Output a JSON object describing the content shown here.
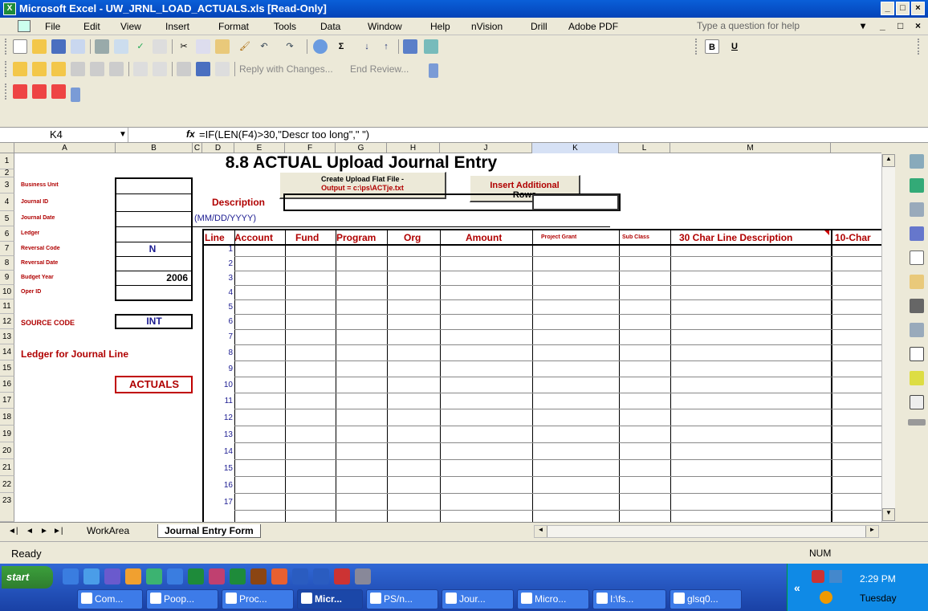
{
  "window": {
    "title": "Microsoft Excel - UW_JRNL_LOAD_ACTUALS.xls [Read-Only]",
    "controls": [
      "_",
      "□",
      "×"
    ]
  },
  "menu": {
    "items": [
      "File",
      "Edit",
      "View",
      "Insert",
      "Format",
      "Tools",
      "Data",
      "Window",
      "Help",
      "nVision",
      "Drill",
      "Adobe PDF"
    ],
    "help_placeholder": "Type a question for help",
    "help_controls": [
      "▾",
      "_",
      "□",
      "×"
    ]
  },
  "toolbar": {
    "reviewing_text": "Reply with Changes...",
    "end_review": "End Review...",
    "font_bold": "B",
    "font_underline": "U"
  },
  "formula_bar": {
    "name_box": "K4",
    "fx": "fx",
    "formula": "=IF(LEN(F4)>30,\"Descr too long\",\" \")"
  },
  "columns": [
    "A",
    "B",
    "C",
    "D",
    "E",
    "F",
    "G",
    "H",
    "J",
    "K",
    "L",
    "M"
  ],
  "rows": [
    "1",
    "2",
    "3",
    "4",
    "5",
    "6",
    "7",
    "8",
    "9",
    "10",
    "11",
    "12",
    "13",
    "14",
    "15",
    "16",
    "17",
    "18",
    "19",
    "20",
    "21",
    "22",
    "23"
  ],
  "sheet": {
    "title": "8.8 ACTUAL Upload Journal Entry",
    "create_button": "Create Upload Flat File - Output = c:\\ps\\ACTje.txt",
    "create_button_line1": "Create Upload Flat File -",
    "create_button_line2": "Output = c:\\ps\\ACTje.txt",
    "insert_button_line1": "Insert Additional",
    "insert_button_line2": "Rows",
    "left_labels": {
      "business_unit": "Business Unit",
      "journal_id": "Journal ID",
      "journal_date": "Journal Date",
      "ledger": "Ledger",
      "reversal_code": "Reversal Code",
      "reversal_date": "Reversal Date",
      "budget_year": "Budget Year",
      "oper_id": "Oper ID",
      "source_code": "SOURCE CODE",
      "ledger_for_line": "Ledger for Journal Line"
    },
    "values": {
      "reversal_code": "N",
      "budget_year": "2006",
      "source_code": "INT",
      "ledger_for_line": "ACTUALS"
    },
    "description_label": "Description",
    "date_hint": "(MM/DD/YYYY)",
    "table_headers": [
      "Line",
      "Account",
      "Fund",
      "Program",
      "Org",
      "Amount",
      "Project Grant",
      "Sub Class",
      "30 Char Line Description",
      "10-Char"
    ],
    "line_numbers": [
      "1",
      "2",
      "3",
      "4",
      "5",
      "6",
      "7",
      "8",
      "9",
      "10",
      "11",
      "12",
      "13",
      "14",
      "15",
      "16",
      "17"
    ]
  },
  "tabs": {
    "items": [
      "WorkArea",
      "Journal Entry Form"
    ],
    "active": "Journal Entry Form"
  },
  "status": {
    "text": "Ready",
    "num": "NUM"
  },
  "taskbar": {
    "start": "start",
    "tasks": [
      "Com...",
      "Poop...",
      "Proc...",
      "Micr...",
      "PS/n...",
      "Jour...",
      "Micro...",
      "I:\\fs...",
      "glsq0..."
    ],
    "time": "2:29 PM",
    "day": "Tuesday",
    "tray_chevron": "«"
  }
}
